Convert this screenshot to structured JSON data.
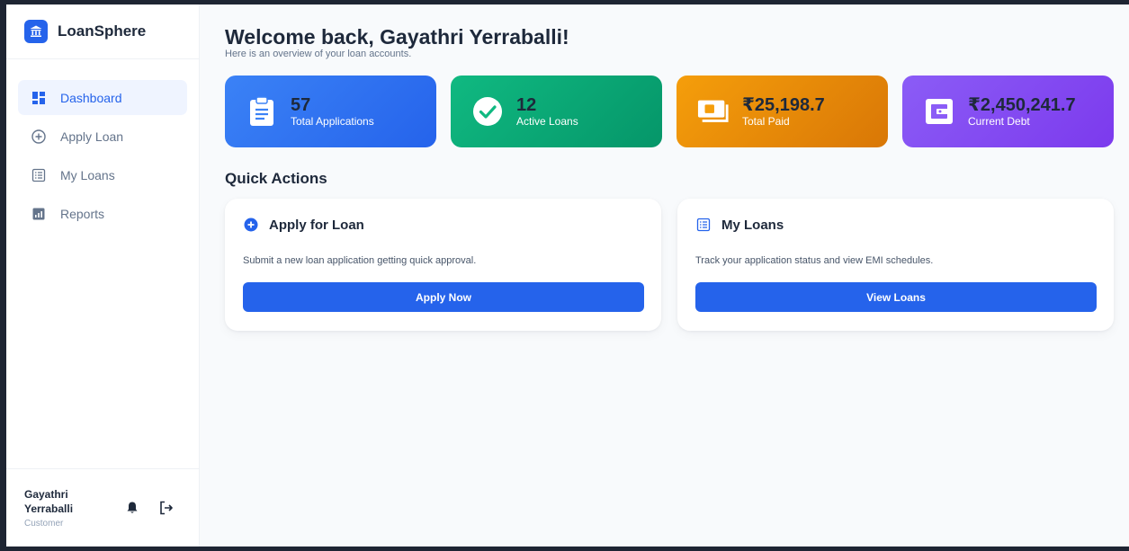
{
  "brand": {
    "name": "LoanSphere",
    "icon": "bank-icon"
  },
  "sidebar": {
    "items": [
      {
        "label": "Dashboard",
        "icon": "dashboard-icon",
        "active": true
      },
      {
        "label": "Apply Loan",
        "icon": "plus-circle-icon",
        "active": false
      },
      {
        "label": "My Loans",
        "icon": "list-icon",
        "active": false
      },
      {
        "label": "Reports",
        "icon": "chart-icon",
        "active": false
      }
    ],
    "user": {
      "name": "Gayathri Yerraballi",
      "role": "Customer"
    }
  },
  "header": {
    "title": "Welcome back, Gayathri Yerraballi!",
    "subtitle": "Here is an overview of your loan accounts."
  },
  "stats": [
    {
      "value": "57",
      "label": "Total Applications",
      "icon": "clipboard-icon",
      "color": "#3b82f6"
    },
    {
      "value": "12",
      "label": "Active Loans",
      "icon": "check-circle-icon",
      "color": "#10b981"
    },
    {
      "value": "₹25,198.7",
      "label": "Total Paid",
      "icon": "money-icon",
      "color": "#f59e0b"
    },
    {
      "value": "₹2,450,241.7",
      "label": "Current Debt",
      "icon": "wallet-icon",
      "color": "#8b5cf6"
    }
  ],
  "quick_actions": {
    "title": "Quick Actions",
    "cards": [
      {
        "title": "Apply for Loan",
        "description": "Submit a new loan application getting quick approval.",
        "button": "Apply Now",
        "icon": "plus-circle-icon"
      },
      {
        "title": "My Loans",
        "description": "Track your application status and view EMI schedules.",
        "button": "View Loans",
        "icon": "list-icon"
      }
    ]
  },
  "colors": {
    "accent": "#2563eb",
    "sidebar_active_bg": "#eff4ff"
  }
}
